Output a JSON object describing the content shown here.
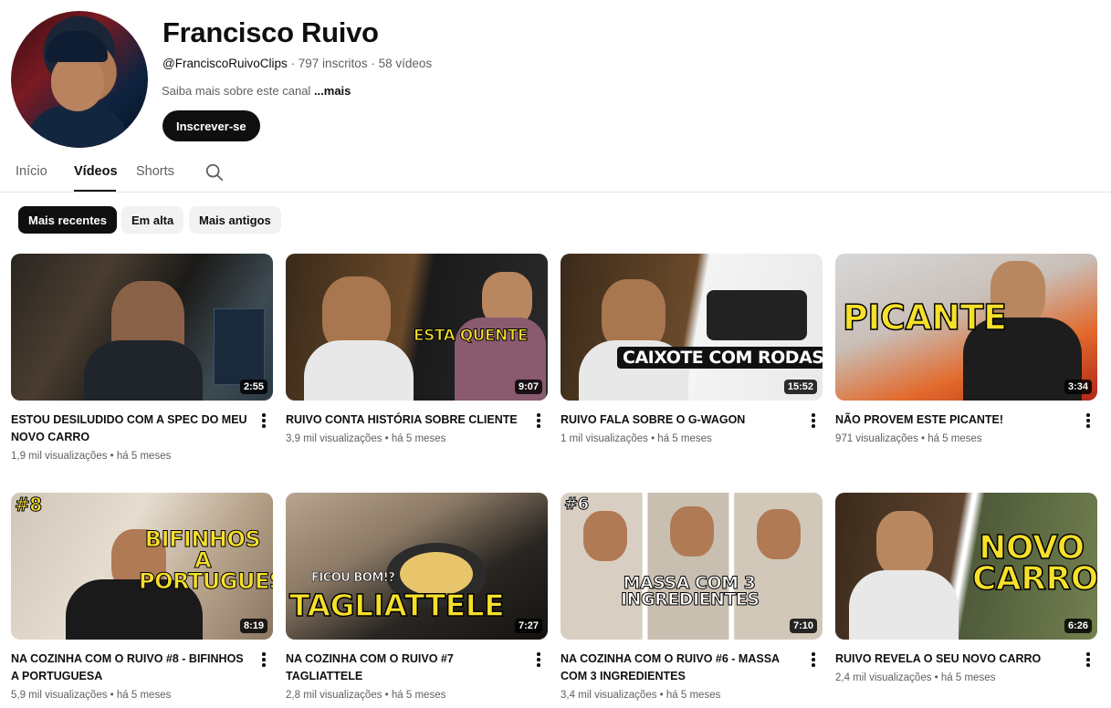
{
  "channel": {
    "name": "Francisco Ruivo",
    "handle": "@FranciscoRuivoClips",
    "subscribers": "797 inscritos",
    "videos_count": "58 vídeos",
    "separator": "·",
    "about": "Saiba mais sobre este canal",
    "about_more": "...mais",
    "subscribe_label": "Inscrever-se"
  },
  "tabs": [
    {
      "label": "Início",
      "active": false
    },
    {
      "label": "Vídeos",
      "active": true
    },
    {
      "label": "Shorts",
      "active": false
    }
  ],
  "chips": [
    {
      "label": "Mais recentes",
      "active": true
    },
    {
      "label": "Em alta",
      "active": false
    },
    {
      "label": "Mais antigos",
      "active": false
    }
  ],
  "videos": [
    {
      "title": "ESTOU DESILUDIDO COM A SPEC DO MEU NOVO CARRO",
      "views": "1,9 mil visualizações",
      "age": "há 5 meses",
      "duration": "2:55",
      "overlay": ""
    },
    {
      "title": "RUIVO CONTA HISTÓRIA SOBRE CLIENTE",
      "views": "3,9 mil visualizações",
      "age": "há 5 meses",
      "duration": "9:07",
      "overlay": "ESTA QUENTE"
    },
    {
      "title": "RUIVO FALA SOBRE O G-WAGON",
      "views": "1 mil visualizações",
      "age": "há 5 meses",
      "duration": "15:52",
      "overlay": "CAIXOTE COM RODAS"
    },
    {
      "title": "NÃO PROVEM ESTE PICANTE!",
      "views": "971 visualizações",
      "age": "há 5 meses",
      "duration": "3:34",
      "overlay": "PICANTE"
    },
    {
      "title": "NA COZINHA COM O RUIVO #8 - BIFINHOS A PORTUGUESA",
      "views": "5,9 mil visualizações",
      "age": "há 5 meses",
      "duration": "8:19",
      "overlay": "BIFINHOS A PORTUGUESA",
      "badge": "#8"
    },
    {
      "title": "NA COZINHA COM O RUIVO #7 TAGLIATTELE",
      "views": "2,8 mil visualizações",
      "age": "há 5 meses",
      "duration": "7:27",
      "overlay": "TAGLIATTELE",
      "overlay_small": "FICOU BOM!?"
    },
    {
      "title": "NA COZINHA COM O RUIVO #6 - MASSA COM 3 INGREDIENTES",
      "views": "3,4 mil visualizações",
      "age": "há 5 meses",
      "duration": "7:10",
      "overlay": "MASSA COM 3 INGREDIENTES",
      "badge": "#6"
    },
    {
      "title": "RUIVO REVELA O SEU NOVO CARRO",
      "views": "2,4 mil visualizações",
      "age": "há 5 meses",
      "duration": "6:26",
      "overlay": "NOVO CARRO"
    }
  ],
  "colors": {
    "text_primary": "#0f0f0f",
    "text_secondary": "#606060",
    "chip_bg": "#f2f2f2",
    "overlay_yellow": "#f6e02a"
  }
}
